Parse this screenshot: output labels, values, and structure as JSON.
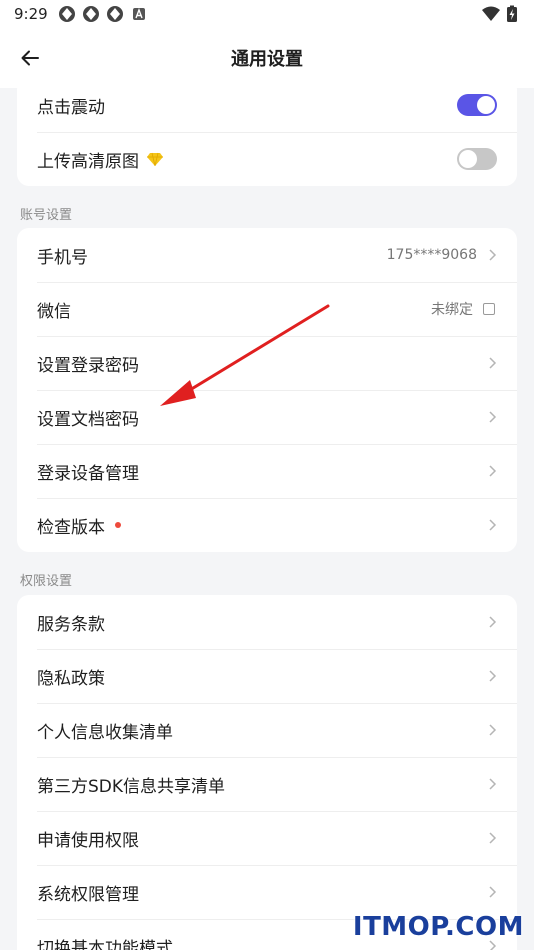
{
  "status_bar": {
    "time": "9:29",
    "icons": [
      "app-icon",
      "app-icon",
      "app-icon",
      "notification-a-icon"
    ],
    "right_icons": [
      "wifi-icon",
      "battery-charging-icon"
    ]
  },
  "appbar": {
    "title": "通用设置",
    "back_icon": "back-arrow-icon"
  },
  "general_card": {
    "items": [
      {
        "label": "点击震动",
        "toggle": "on"
      },
      {
        "label": "上传高清原图",
        "toggle": "off",
        "badge_icon": "diamond-icon"
      }
    ]
  },
  "account_section": {
    "title": "账号设置",
    "items": [
      {
        "label": "手机号",
        "value": "175****9068"
      },
      {
        "label": "微信",
        "value": "未绑定"
      },
      {
        "label": "设置登录密码"
      },
      {
        "label": "设置文档密码"
      },
      {
        "label": "登录设备管理"
      },
      {
        "label": "检查版本",
        "badge": "red-dot"
      }
    ]
  },
  "permission_section": {
    "title": "权限设置",
    "items": [
      {
        "label": "服务条款"
      },
      {
        "label": "隐私政策"
      },
      {
        "label": "个人信息收集清单"
      },
      {
        "label": "第三方SDK信息共享清单"
      },
      {
        "label": "申请使用权限"
      },
      {
        "label": "系统权限管理"
      },
      {
        "label": "切换基本功能模式"
      }
    ]
  },
  "colors": {
    "accent": "#5a55e6",
    "toggle_off": "#c7c7c7",
    "red_dot": "#ee4a3c",
    "background": "#f4f5f7",
    "annotation_arrow": "#e02020"
  },
  "watermark": "ITMOP.COM"
}
